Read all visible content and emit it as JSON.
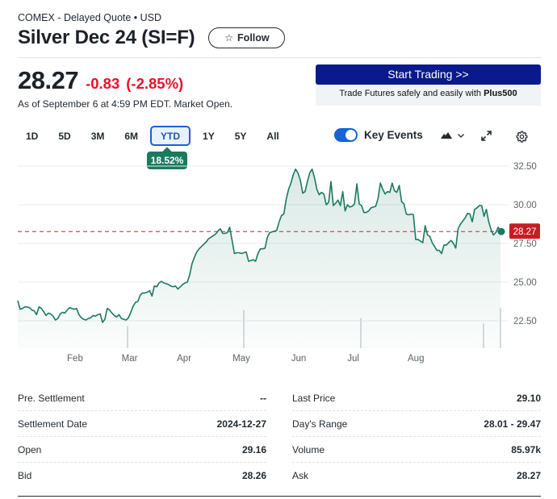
{
  "header": {
    "exchange_line": "COMEX - Delayed Quote • USD",
    "title": "Silver Dec 24 (SI=F)",
    "follow_label": "Follow",
    "follow_icon": "star-icon"
  },
  "quote": {
    "price": "28.27",
    "change": "-0.83",
    "change_pct": "(-2.85%)",
    "as_of": "As of September 6 at 4:59 PM EDT. Market Open.",
    "colors": {
      "negative": "#eb0f29",
      "positive": "#1a7a60"
    }
  },
  "ad": {
    "button_label": "Start Trading >>",
    "text_prefix": "Trade Futures safely and easily with ",
    "text_brand": "Plus500",
    "button_color": "#0a1a8c"
  },
  "range_tabs": [
    {
      "label": "1D",
      "active": false
    },
    {
      "label": "5D",
      "active": false
    },
    {
      "label": "3M",
      "active": false
    },
    {
      "label": "6M",
      "active": false
    },
    {
      "label": "YTD",
      "active": true
    },
    {
      "label": "1Y",
      "active": false
    },
    {
      "label": "5Y",
      "active": false
    },
    {
      "label": "All",
      "active": false
    }
  ],
  "ytd_badge": "18.52%",
  "chart_controls": {
    "key_events_label": "Key Events",
    "key_events_on": true,
    "chart_type_icon": "mountain-icon",
    "expand_icon": "expand-icon",
    "settings_icon": "gear-icon"
  },
  "chart_data": {
    "type": "area",
    "title": "",
    "xlabel": "",
    "ylabel": "",
    "x_tick_labels": [
      "Feb",
      "Mar",
      "Apr",
      "May",
      "Jun",
      "Jul",
      "Aug"
    ],
    "y_tick_labels": [
      "32.50",
      "30.00",
      "27.50",
      "25.00",
      "22.50"
    ],
    "y_ticks": [
      32.5,
      30.0,
      27.5,
      25.0,
      22.5
    ],
    "ylim": [
      21.0,
      32.5
    ],
    "grid": true,
    "y_axis_position": "right",
    "reference_line": {
      "value": 28.27,
      "label": "28.27",
      "style": "dashed",
      "color": "#c0282d"
    },
    "last_point_label": "28.27",
    "line_color": "#1a7a60",
    "series": [
      {
        "name": "Silver Dec 24 (SI=F)",
        "start": "Jan 2",
        "end": "Sep 6",
        "values": [
          23.8,
          23.25,
          23.3,
          23.4,
          23.4,
          23.35,
          23.2,
          23.15,
          22.9,
          23.4,
          23.3,
          23.1,
          22.85,
          23.0,
          22.95,
          22.8,
          22.55,
          22.65,
          22.95,
          23.05,
          23.0,
          23.2,
          23.35,
          23.3,
          23.25,
          23.3,
          22.9,
          22.7,
          22.6,
          22.55,
          22.65,
          22.7,
          22.85,
          22.8,
          22.9,
          22.95,
          22.4,
          22.6,
          23.3,
          23.2,
          23.0,
          22.85,
          22.75,
          22.9,
          22.65,
          22.6,
          22.55,
          22.7,
          23.05,
          23.45,
          23.7,
          23.75,
          24.15,
          24.3,
          24.3,
          24.35,
          24.45,
          24.1,
          24.75,
          24.7,
          24.95,
          25.05,
          24.95,
          24.9,
          24.85,
          24.75,
          24.7,
          24.75,
          24.55,
          24.7,
          24.85,
          24.95,
          25.0,
          25.45,
          26.2,
          26.6,
          26.95,
          27.15,
          27.3,
          27.45,
          27.6,
          27.8,
          27.9,
          28.0,
          28.1,
          28.3,
          28.45,
          28.15,
          28.15,
          28.2,
          28.55,
          27.7,
          26.85,
          26.9,
          26.9,
          26.85,
          26.9,
          26.95,
          26.35,
          26.4,
          26.45,
          26.35,
          26.85,
          27.15,
          27.15,
          27.2,
          27.9,
          28.2,
          28.25,
          28.3,
          28.35,
          28.9,
          29.3,
          29.4,
          30.35,
          31.0,
          31.4,
          31.95,
          32.3,
          32.05,
          31.6,
          30.75,
          30.85,
          31.5,
          32.05,
          32.3,
          31.75,
          31.0,
          30.65,
          30.8,
          30.7,
          30.0,
          30.15,
          31.5,
          29.95,
          30.1,
          30.3,
          29.95,
          30.85,
          29.6,
          30.0,
          29.85,
          29.9,
          30.05,
          31.35,
          30.05,
          29.95,
          29.5,
          29.5,
          29.6,
          29.8,
          29.85,
          29.9,
          30.4,
          31.4,
          31.0,
          30.7,
          30.85,
          30.8,
          31.4,
          30.9,
          30.8,
          31.25,
          30.2,
          30.05,
          29.4,
          29.35,
          29.4,
          29.35,
          27.75,
          27.75,
          27.65,
          27.55,
          28.65,
          28.05,
          27.95,
          27.55,
          27.3,
          27.05,
          27.05,
          26.85,
          27.4,
          27.4,
          27.55,
          27.7,
          27.5,
          27.2,
          28.45,
          28.75,
          28.95,
          29.15,
          29.45,
          29.4,
          28.9,
          29.7,
          29.8,
          29.95,
          29.95,
          29.25,
          29.7,
          28.9,
          28.4,
          28.05,
          28.2,
          28.55,
          28.27
        ]
      }
    ],
    "volume_markers": [
      {
        "date": "Mar 1",
        "relative_height": 0.55
      },
      {
        "date": "Apr 30",
        "relative_height": 0.95
      },
      {
        "date": "Jun 28",
        "relative_height": 0.75
      },
      {
        "date": "Aug 30",
        "relative_height": 0.62
      },
      {
        "date": "Sep 6",
        "relative_height": 1.0
      }
    ]
  },
  "stats": {
    "left": [
      {
        "label": "Pre. Settlement",
        "value": "--"
      },
      {
        "label": "Settlement Date",
        "value": "2024-12-27"
      },
      {
        "label": "Open",
        "value": "29.16"
      },
      {
        "label": "Bid",
        "value": "28.26"
      }
    ],
    "right": [
      {
        "label": "Last Price",
        "value": "29.10"
      },
      {
        "label": "Day's Range",
        "value": "28.01 - 29.47"
      },
      {
        "label": "Volume",
        "value": "85.97k"
      },
      {
        "label": "Ask",
        "value": "28.27"
      }
    ]
  }
}
